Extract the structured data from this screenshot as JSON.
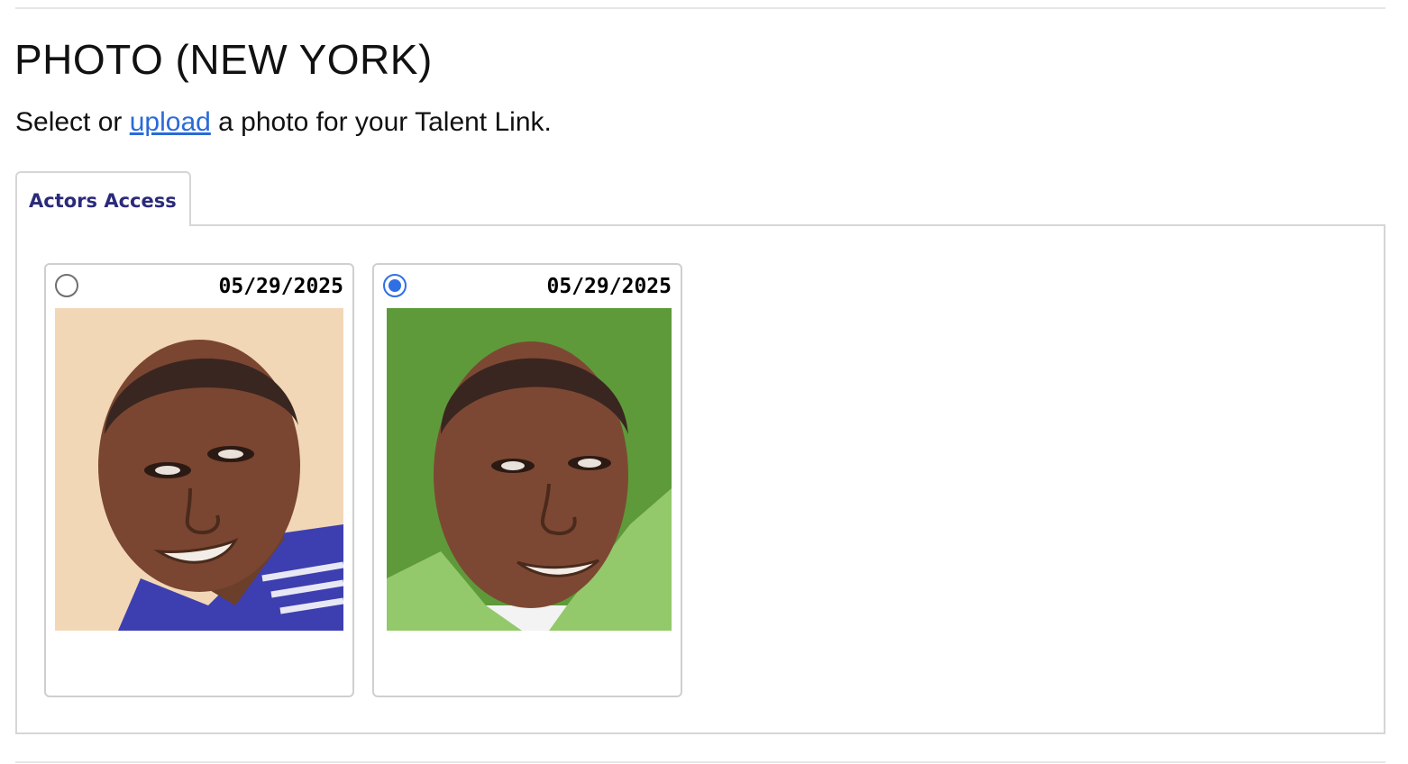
{
  "header": {
    "title": "PHOTO (NEW YORK)"
  },
  "intro": {
    "prefix": "Select or ",
    "link_label": "upload",
    "suffix": " a photo for your Talent Link."
  },
  "tabs": [
    {
      "label": "Actors Access",
      "active": true
    }
  ],
  "photos": [
    {
      "date": "05/29/2025",
      "selected": false,
      "background_color": "#f2d7b6",
      "shirt_color": "#3d3fb0"
    },
    {
      "date": "05/29/2025",
      "selected": true,
      "background_color": "#5e9a3a",
      "shirt_color": "#93c96a"
    }
  ],
  "colors": {
    "link": "#2a6ad8",
    "tab_label": "#2b2a7a",
    "radio_selected": "#2f6fe6"
  }
}
